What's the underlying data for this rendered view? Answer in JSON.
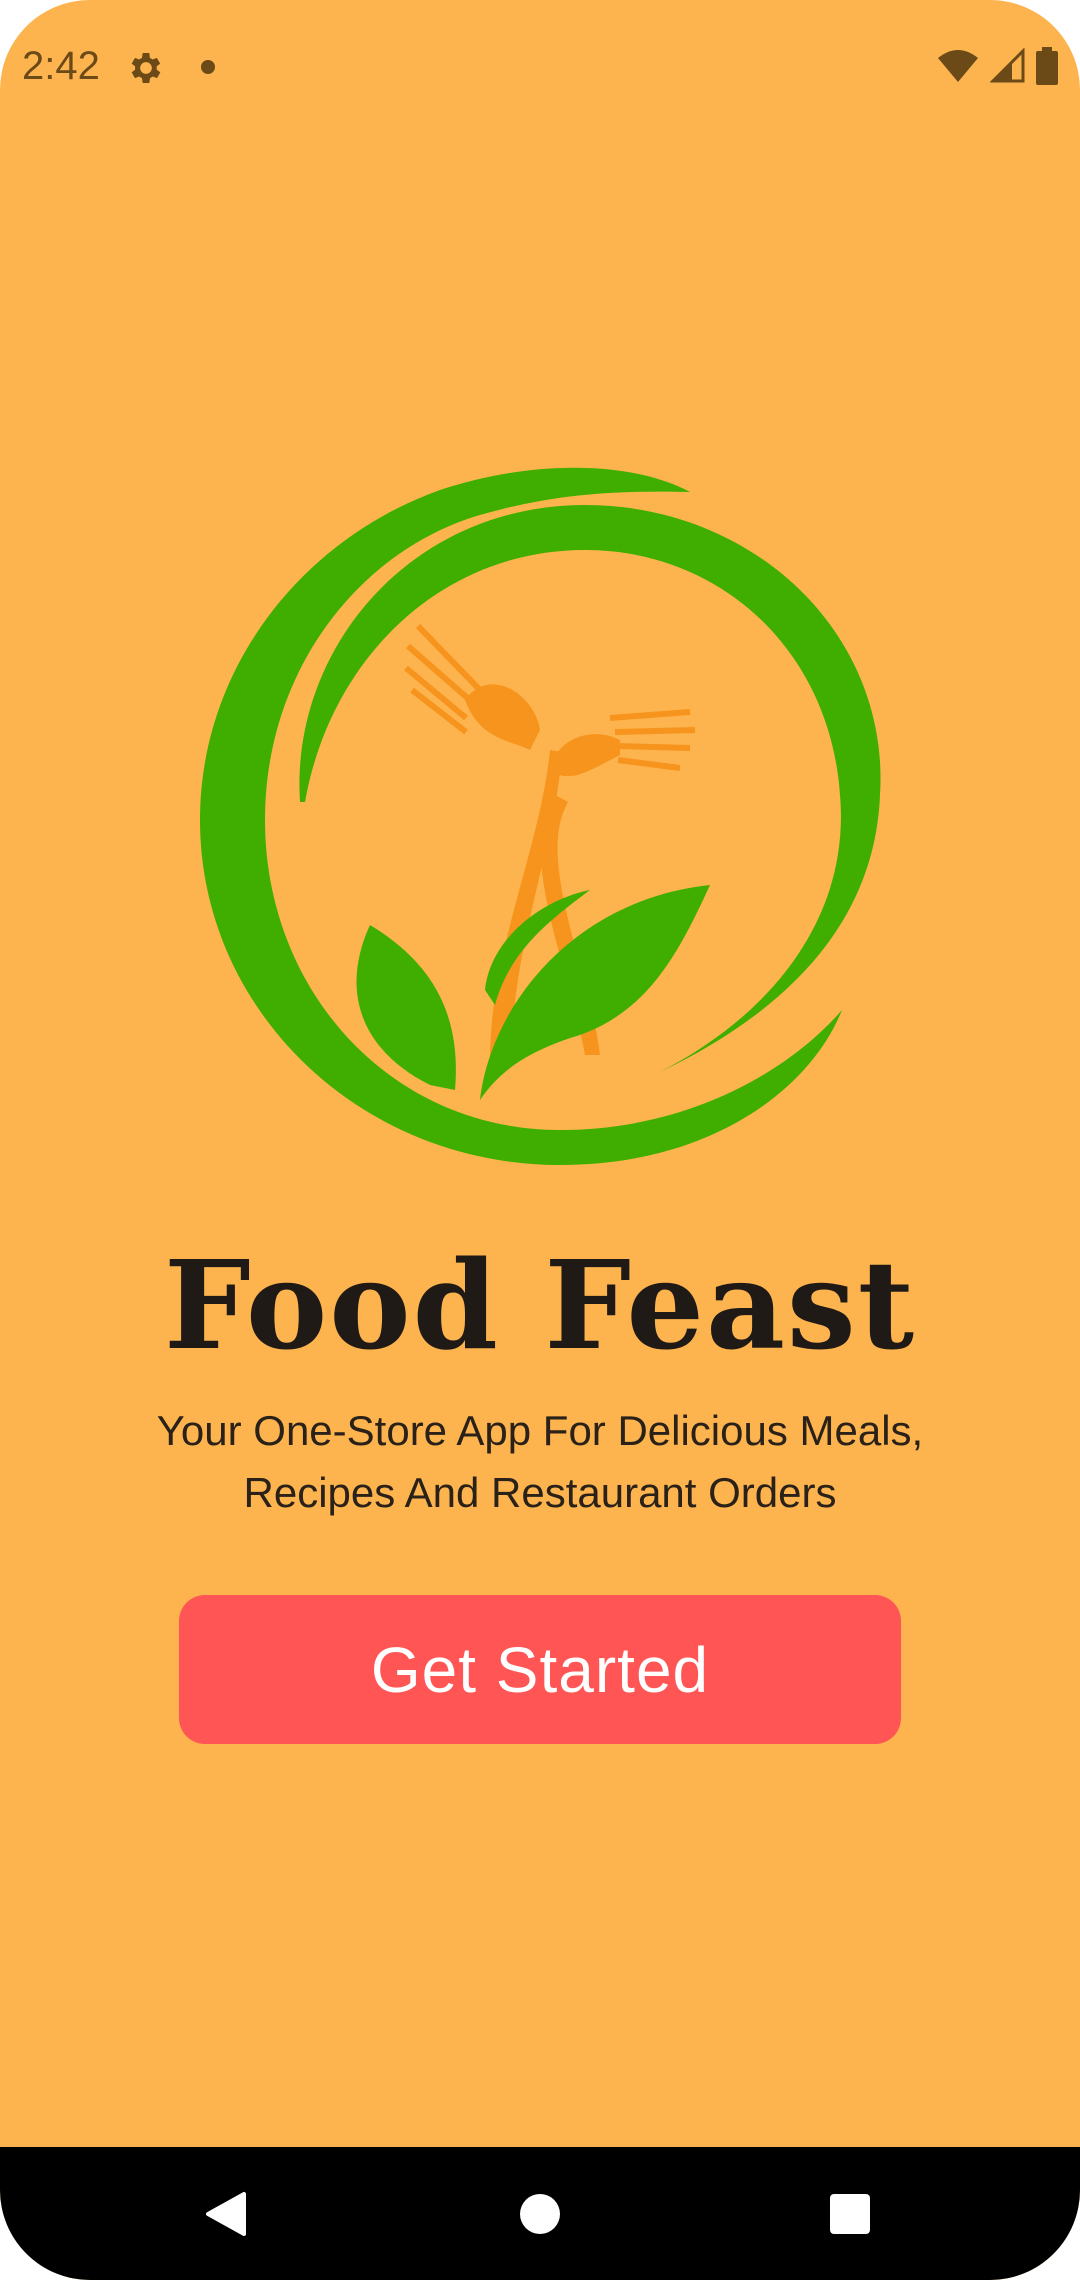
{
  "status_bar": {
    "time": "2:42",
    "icons": [
      "gear-icon",
      "notification-dot-icon",
      "wifi-icon",
      "signal-icon",
      "battery-icon"
    ],
    "text_color": "#6b4a17"
  },
  "app": {
    "name": "Food Feast",
    "tagline_line1": "Your One-Store App For Delicious Meals,",
    "tagline_line2": "Recipes And Restaurant Orders",
    "cta_label": "Get Started",
    "logo_icon": "fork-leaf-logo-icon"
  },
  "colors": {
    "background": "#FDB44E",
    "accent_green": "#3FAE00",
    "fork_orange": "#F7941D",
    "button": "#FF5555",
    "title_text": "#1f1a16"
  },
  "nav_bar": {
    "icons": [
      "back-icon",
      "home-icon",
      "recents-icon"
    ]
  }
}
